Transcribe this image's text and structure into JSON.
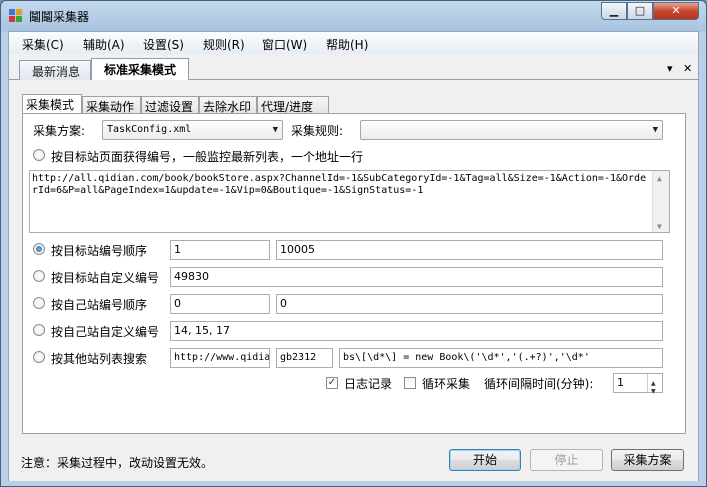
{
  "window": {
    "title": "鬮鬮采集器",
    "min_glyph": "▁",
    "max_glyph": "□",
    "close_glyph": "✕"
  },
  "menu": [
    "采集(C)",
    "辅助(A)",
    "设置(S)",
    "规则(R)",
    "窗口(W)",
    "帮助(H)"
  ],
  "doc_tabs": {
    "tabs": [
      "最新消息",
      "标准采集模式"
    ],
    "active": 1,
    "dropdown_glyph": "▾",
    "close_glyph": "✕"
  },
  "inner_tabs": {
    "tabs": [
      "采集模式",
      "采集动作",
      "过滤设置",
      "去除水印",
      "代理/进度"
    ],
    "active": 0
  },
  "scheme": {
    "label": "采集方案:",
    "value": "TaskConfig.xml",
    "rule_label": "采集规则:",
    "rule_value": ""
  },
  "list_option": {
    "label": "按目标站页面获得编号，一般监控最新列表，一个地址一行",
    "checked": false
  },
  "url_text": "http://all.qidian.com/book/bookStore.aspx?ChannelId=-1&SubCategoryId=-1&Tag=all&Size=-1&Action=-1&OrderId=6&P=all&PageIndex=1&update=-1&Vip=0&Boutique=-1&SignStatus=-1",
  "modes": [
    {
      "label": "按目标站编号顺序",
      "checked": true,
      "v1": "1",
      "v2": "10005"
    },
    {
      "label": "按目标站自定义编号",
      "checked": false,
      "v1": "49830"
    },
    {
      "label": "按自己站编号顺序",
      "checked": false,
      "v1": "0",
      "v2": "0"
    },
    {
      "label": "按自己站自定义编号",
      "checked": false,
      "v1": "14, 15, 17"
    },
    {
      "label": "按其他站列表搜索",
      "checked": false,
      "v1": "http://www.qidian.com",
      "v2": "gb2312",
      "v3": "bs\\[\\d*\\] = new Book\\('\\d*','(.+?)','\\d*'"
    }
  ],
  "options": {
    "log_label": "日志记录",
    "log_checked": true,
    "loop_label": "循环采集",
    "loop_checked": false,
    "interval_label": "循环间隔时间(分钟):",
    "interval_value": "1"
  },
  "footer": {
    "note": "注意：采集过程中，改动设置无效。",
    "start": "开始",
    "stop": "停止",
    "scheme": "采集方案"
  }
}
